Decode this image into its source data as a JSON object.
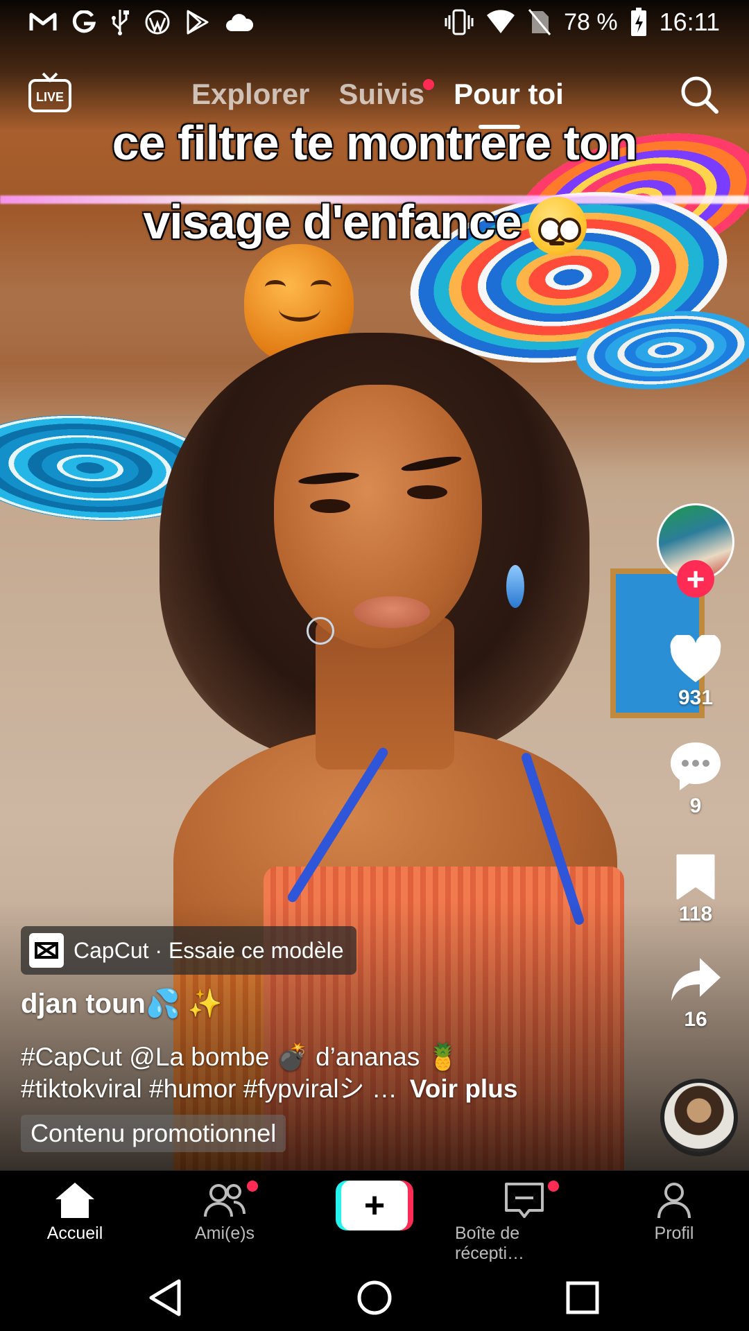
{
  "status_bar": {
    "left_icons": [
      "gmail-icon",
      "google-icon",
      "usb-icon",
      "wordpress-icon",
      "play-store-icon",
      "cloud-icon"
    ],
    "right_icons": [
      "vibrate-icon",
      "wifi-icon",
      "no-sim-icon",
      "battery-charging-icon"
    ],
    "battery": "78 %",
    "time": "16:11"
  },
  "top_nav": {
    "live_label": "LIVE",
    "tabs": [
      {
        "label": "Explorer",
        "active": false
      },
      {
        "label": "Suivis",
        "active": false,
        "has_dot": true
      },
      {
        "label": "Pour toi",
        "active": true
      }
    ]
  },
  "video": {
    "overlay_line1": "ce filtre te montrere ton",
    "overlay_line2": "visage d'enfance"
  },
  "actions": {
    "likes": "931",
    "comments": "9",
    "bookmarks": "118",
    "shares": "16"
  },
  "info": {
    "capcut_chip": "CapCut · Essaie ce modèle",
    "author": "djan toun💦 ✨",
    "description_line1": "#CapCut @La bombe 💣 d’ananas 🍍",
    "description_line2": "#tiktokviral #humor #fypviralシ …",
    "see_more": "Voir plus",
    "promo_label": "Contenu promotionnel"
  },
  "bottom_nav": {
    "home": "Accueil",
    "friends": "Ami(e)s",
    "create": "+",
    "inbox": "Boîte de récepti…",
    "profile": "Profil"
  },
  "colors": {
    "accent_red": "#fe2c55",
    "accent_cyan": "#25f4ee",
    "background": "#000000"
  }
}
